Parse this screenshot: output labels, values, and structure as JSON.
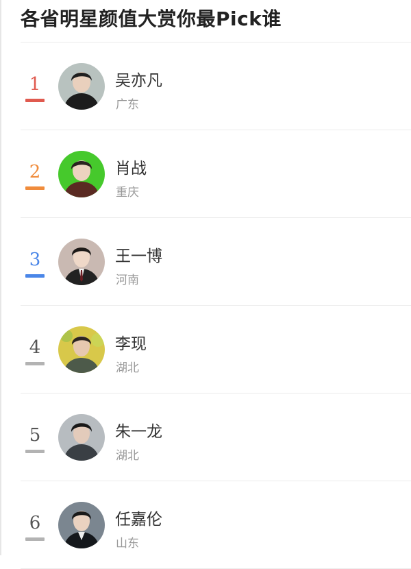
{
  "title": "各省明星颜值大赏你最Pick谁",
  "colors": {
    "rank1": "#e05a4f",
    "rank2": "#f08c3c",
    "rank3": "#4a86e8",
    "rank_other": "#9a9a9a",
    "divider": "#ececec"
  },
  "ranking": [
    {
      "rank": "1",
      "name": "吴亦凡",
      "province": "广东",
      "avatar_bg": "#b8c2bf",
      "icon": "avatar-photo"
    },
    {
      "rank": "2",
      "name": "肖战",
      "province": "重庆",
      "avatar_bg": "#46c92c",
      "icon": "avatar-photo"
    },
    {
      "rank": "3",
      "name": "王一博",
      "province": "河南",
      "avatar_bg": "#c9b9b2",
      "icon": "avatar-photo"
    },
    {
      "rank": "4",
      "name": "李现",
      "province": "湖北",
      "avatar_bg": "#d8c84a",
      "icon": "avatar-photo"
    },
    {
      "rank": "5",
      "name": "朱一龙",
      "province": "湖北",
      "avatar_bg": "#b7bcc0",
      "icon": "avatar-photo"
    },
    {
      "rank": "6",
      "name": "任嘉伦",
      "province": "山东",
      "avatar_bg": "#7b8690",
      "icon": "avatar-photo"
    }
  ]
}
